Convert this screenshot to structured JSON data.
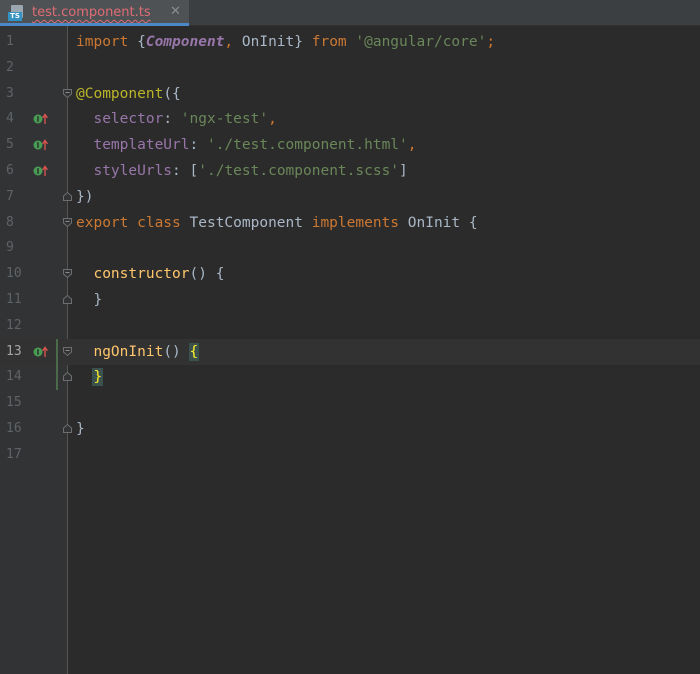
{
  "tab": {
    "filename": "test.component.ts",
    "icon": "typescript-file-icon",
    "badge": "TS",
    "close_glyph": "✕"
  },
  "editor": {
    "caret_line": 13,
    "lines": [
      {
        "n": "1",
        "tokens": [
          [
            "kw",
            "import "
          ],
          [
            "def",
            "{"
          ],
          [
            "ital",
            "Component"
          ],
          [
            "kw",
            ", "
          ],
          [
            "def",
            "OnInit} "
          ],
          [
            "kw",
            "from "
          ],
          [
            "str",
            "'@angular/core'"
          ],
          [
            "kw",
            ";"
          ]
        ]
      },
      {
        "n": "2",
        "tokens": []
      },
      {
        "n": "3",
        "tokens": [
          [
            "anno",
            "@Component"
          ],
          [
            "def",
            "({"
          ]
        ],
        "fold": "open"
      },
      {
        "n": "4",
        "tokens": [
          [
            "def",
            "  "
          ],
          [
            "field",
            "selector"
          ],
          [
            "def",
            ": "
          ],
          [
            "str",
            "'ngx-test'"
          ],
          [
            "kw",
            ","
          ]
        ],
        "marker": true
      },
      {
        "n": "5",
        "tokens": [
          [
            "def",
            "  "
          ],
          [
            "field",
            "templateUrl"
          ],
          [
            "def",
            ": "
          ],
          [
            "str",
            "'./test.component.html'"
          ],
          [
            "kw",
            ","
          ]
        ],
        "marker": true
      },
      {
        "n": "6",
        "tokens": [
          [
            "def",
            "  "
          ],
          [
            "field",
            "styleUrls"
          ],
          [
            "def",
            ": ["
          ],
          [
            "str",
            "'./test.component.scss'"
          ],
          [
            "def",
            "]"
          ]
        ],
        "marker": true
      },
      {
        "n": "7",
        "tokens": [
          [
            "def",
            "})"
          ]
        ],
        "fold": "close"
      },
      {
        "n": "8",
        "tokens": [
          [
            "kw",
            "export class "
          ],
          [
            "def",
            "TestComponent "
          ],
          [
            "kw",
            "implements "
          ],
          [
            "def",
            "OnInit {"
          ]
        ],
        "fold": "open"
      },
      {
        "n": "9",
        "tokens": []
      },
      {
        "n": "10",
        "tokens": [
          [
            "def",
            "  "
          ],
          [
            "fn",
            "constructor"
          ],
          [
            "def",
            "() {"
          ]
        ],
        "fold": "open"
      },
      {
        "n": "11",
        "tokens": [
          [
            "def",
            "  }"
          ]
        ],
        "fold": "close"
      },
      {
        "n": "12",
        "tokens": []
      },
      {
        "n": "13",
        "tokens": [
          [
            "def",
            "  "
          ],
          [
            "fn",
            "ngOnInit"
          ],
          [
            "def",
            "() "
          ],
          [
            "brace",
            "{"
          ]
        ],
        "fold": "open",
        "marker": true
      },
      {
        "n": "14",
        "tokens": [
          [
            "def",
            "  "
          ],
          [
            "brace",
            "}"
          ]
        ],
        "fold": "close"
      },
      {
        "n": "15",
        "tokens": []
      },
      {
        "n": "16",
        "tokens": [
          [
            "def",
            "}"
          ]
        ],
        "fold": "close"
      },
      {
        "n": "17",
        "tokens": []
      }
    ]
  },
  "colors": {
    "background": "#2b2b2b",
    "gutter": "#313335",
    "keyword": "#cc7832",
    "string": "#6a8759",
    "field": "#9876aa",
    "function": "#ffc66d",
    "annotation": "#bbb529",
    "default": "#a9b7c6",
    "tab_error_text": "#e06c75"
  }
}
